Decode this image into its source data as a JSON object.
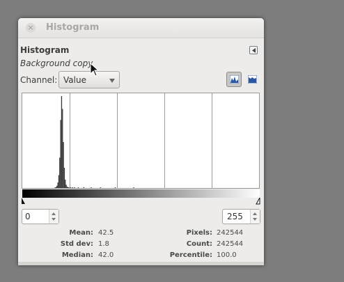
{
  "window": {
    "title": "Histogram",
    "close_glyph": "×"
  },
  "dock": {
    "title": "Histogram",
    "layer_name": "Background copy",
    "menu_icon": "tab-menu-icon"
  },
  "channel": {
    "label": "Channel:",
    "value": "Value"
  },
  "mode_buttons": [
    {
      "name": "linear-histogram",
      "icon": "linear-histogram-icon",
      "active": true
    },
    {
      "name": "logarithmic-histogram",
      "icon": "log-histogram-icon",
      "active": false
    }
  ],
  "range": {
    "low": "0",
    "high": "255"
  },
  "stats": {
    "mean_label": "Mean:",
    "mean": "42.5",
    "std_label": "Std dev:",
    "std": "1.8",
    "median_label": "Median:",
    "median": "42.0",
    "pixels_label": "Pixels:",
    "pixels": "242544",
    "count_label": "Count:",
    "count": "242544",
    "percentile_label": "Percentile:",
    "percentile": "100.0"
  },
  "chart_data": {
    "type": "bar",
    "x_range": [
      0,
      255
    ],
    "ylim": [
      0,
      1
    ],
    "grid": true,
    "grid_divisions": 5,
    "series": [
      {
        "x": [
          35,
          36,
          37,
          38,
          39,
          40,
          41,
          42,
          43,
          44,
          45,
          46,
          47,
          48,
          49,
          50,
          52,
          54,
          56,
          60,
          66,
          74,
          84,
          100,
          120
        ],
        "values": [
          0.004,
          0.01,
          0.025,
          0.06,
          0.14,
          0.33,
          0.74,
          1.0,
          0.86,
          0.5,
          0.22,
          0.09,
          0.035,
          0.015,
          0.008,
          0.006,
          0.005,
          0.004,
          0.004,
          0.003,
          0.003,
          0.002,
          0.002,
          0.002,
          0.002
        ]
      }
    ]
  },
  "colors": {
    "background": "#7d7d7d",
    "window": "#edecea",
    "histogram_fill": "#3a3a3a",
    "grid": "#9c9c9c"
  }
}
